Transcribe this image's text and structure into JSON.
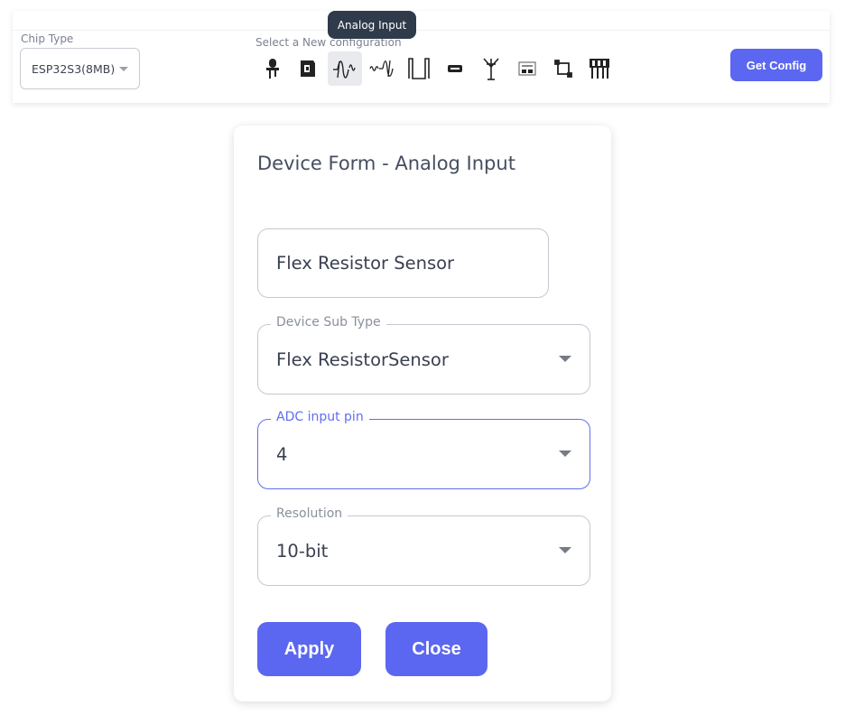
{
  "toolbar": {
    "chip_type_label": "Chip Type",
    "chip_type_value": "ESP32S3(8MB)",
    "select_config_label": "Select a New configuration",
    "tooltip": "Analog Input",
    "get_config_label": "Get Config",
    "icons": [
      "led-icon",
      "relay-icon",
      "analog-input-icon",
      "analog-output-icon",
      "digital-pulse-icon",
      "display-icon",
      "antenna-icon",
      "module-board-icon",
      "i2c-bus-icon",
      "connector-pins-icon"
    ]
  },
  "form": {
    "title": "Device Form - Analog Input",
    "name_value": "Flex Resistor Sensor",
    "device_sub_type_label": "Device Sub Type",
    "device_sub_type_value": "Flex ResistorSensor",
    "adc_pin_label": "ADC input pin",
    "adc_pin_value": "4",
    "resolution_label": "Resolution",
    "resolution_value": "10-bit",
    "apply_label": "Apply",
    "close_label": "Close"
  },
  "colors": {
    "accent": "#5b67f0",
    "tooltip_bg": "#2f3a4a",
    "text": "#454e60"
  }
}
